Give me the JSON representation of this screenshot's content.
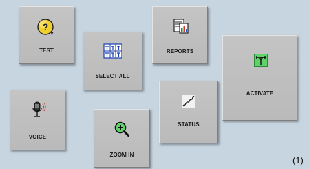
{
  "buttons": {
    "test": {
      "label": "TEST",
      "icon": "question-icon"
    },
    "reports": {
      "label": "REPORTS",
      "icon": "report-chart-icon"
    },
    "select_all": {
      "label": "SELECT ALL",
      "icon": "grid-select-icon"
    },
    "activate": {
      "label": "ACTIVATE",
      "icon": "antenna-icon"
    },
    "status": {
      "label": "STATUS",
      "icon": "wave-status-icon"
    },
    "voice": {
      "label": "VOICE",
      "icon": "microphone-icon"
    },
    "zoom_in": {
      "label": "ZOOM IN",
      "icon": "zoom-in-icon"
    }
  },
  "figure_number": "(1)",
  "colors": {
    "background": "#c7d5e0",
    "tile": "#bfbfbf",
    "icon_green": "#5fd36a",
    "icon_yellow": "#f2d02b"
  }
}
